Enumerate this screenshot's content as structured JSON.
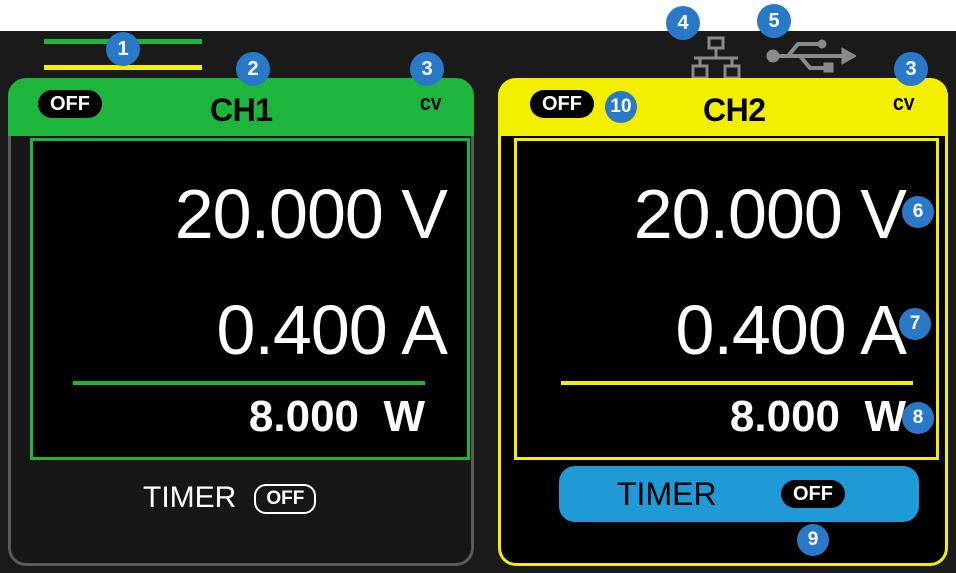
{
  "channels": [
    {
      "name": "CH1",
      "output_state": "OFF",
      "mode": "CV",
      "voltage": "20.000 V",
      "current": "0.400 A",
      "power": "8.000  W",
      "timer_label": "TIMER",
      "timer_state": "OFF",
      "color": "#1db53b"
    },
    {
      "name": "CH2",
      "output_state": "OFF",
      "mode": "CV",
      "voltage": "20.000 V",
      "current": "0.400 A",
      "power": "8.000  W",
      "timer_label": "TIMER",
      "timer_state": "OFF",
      "color": "#f4ef00"
    }
  ],
  "indicators": {
    "tracking_icon": "parallel-lines-icon",
    "network_icon": "lan-icon",
    "usb_icon": "usb-icon"
  },
  "markers": [
    "1",
    "2",
    "3",
    "4",
    "5",
    "3",
    "10",
    "6",
    "7",
    "8",
    "9"
  ],
  "colors": {
    "marker": "#2a79c9",
    "timer_bar": "#1f9ad6",
    "background": "#1a1a1a"
  }
}
